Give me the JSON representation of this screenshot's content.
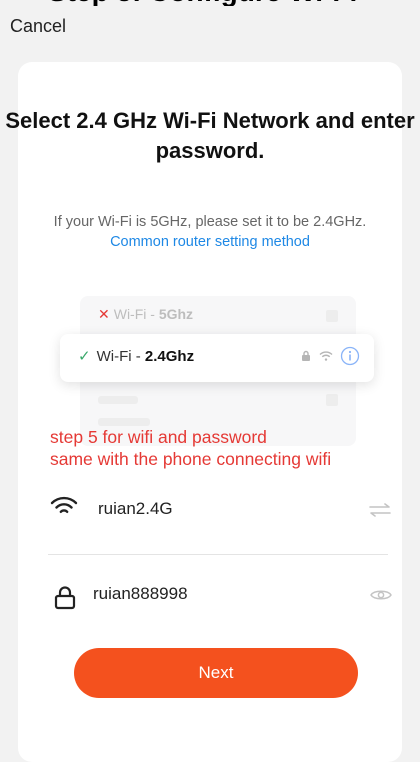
{
  "header": {
    "cancel_label": "Cancel"
  },
  "title": "Select 2.4 GHz Wi-Fi Network and enter password.",
  "subtitle": {
    "text": "If your Wi-Fi is 5GHz, please set it to be 2.4GHz.",
    "link": "Common router setting method"
  },
  "illustration": {
    "row_5g_prefix": "Wi-Fi - ",
    "row_5g_band": "5Ghz",
    "row_24_prefix": "Wi-Fi - ",
    "row_24_band": "2.4Ghz"
  },
  "annotation": {
    "line1": "step 5 for wifi and password",
    "line2": "same with the phone connecting wifi"
  },
  "form": {
    "ssid_value": "ruian2.4G",
    "password_value": "ruian888998"
  },
  "next_label": "Next",
  "colors": {
    "accent": "#f4511e",
    "link": "#1e88e5",
    "annotation": "#e53935"
  }
}
